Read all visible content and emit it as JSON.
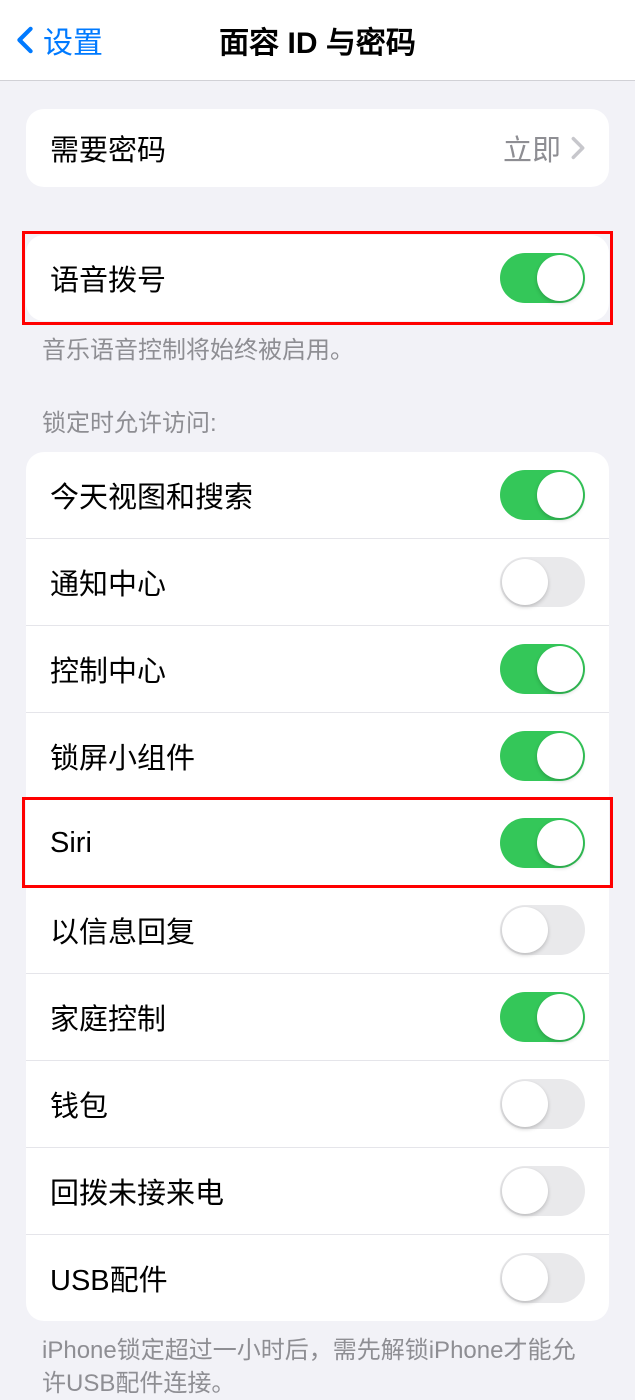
{
  "header": {
    "back_label": "设置",
    "title": "面容 ID 与密码"
  },
  "require_passcode": {
    "label": "需要密码",
    "value": "立即"
  },
  "voice_dial": {
    "label": "语音拨号",
    "enabled": true,
    "footer": "音乐语音控制将始终被启用。"
  },
  "lock_access": {
    "header": "锁定时允许访问:",
    "items": [
      {
        "label": "今天视图和搜索",
        "enabled": true
      },
      {
        "label": "通知中心",
        "enabled": false
      },
      {
        "label": "控制中心",
        "enabled": true
      },
      {
        "label": "锁屏小组件",
        "enabled": true
      },
      {
        "label": "Siri",
        "enabled": true
      },
      {
        "label": "以信息回复",
        "enabled": false
      },
      {
        "label": "家庭控制",
        "enabled": true
      },
      {
        "label": "钱包",
        "enabled": false
      },
      {
        "label": "回拨未接来电",
        "enabled": false
      },
      {
        "label": "USB配件",
        "enabled": false
      }
    ],
    "footer": "iPhone锁定超过一小时后，需先解锁iPhone才能允许USB配件连接。"
  }
}
